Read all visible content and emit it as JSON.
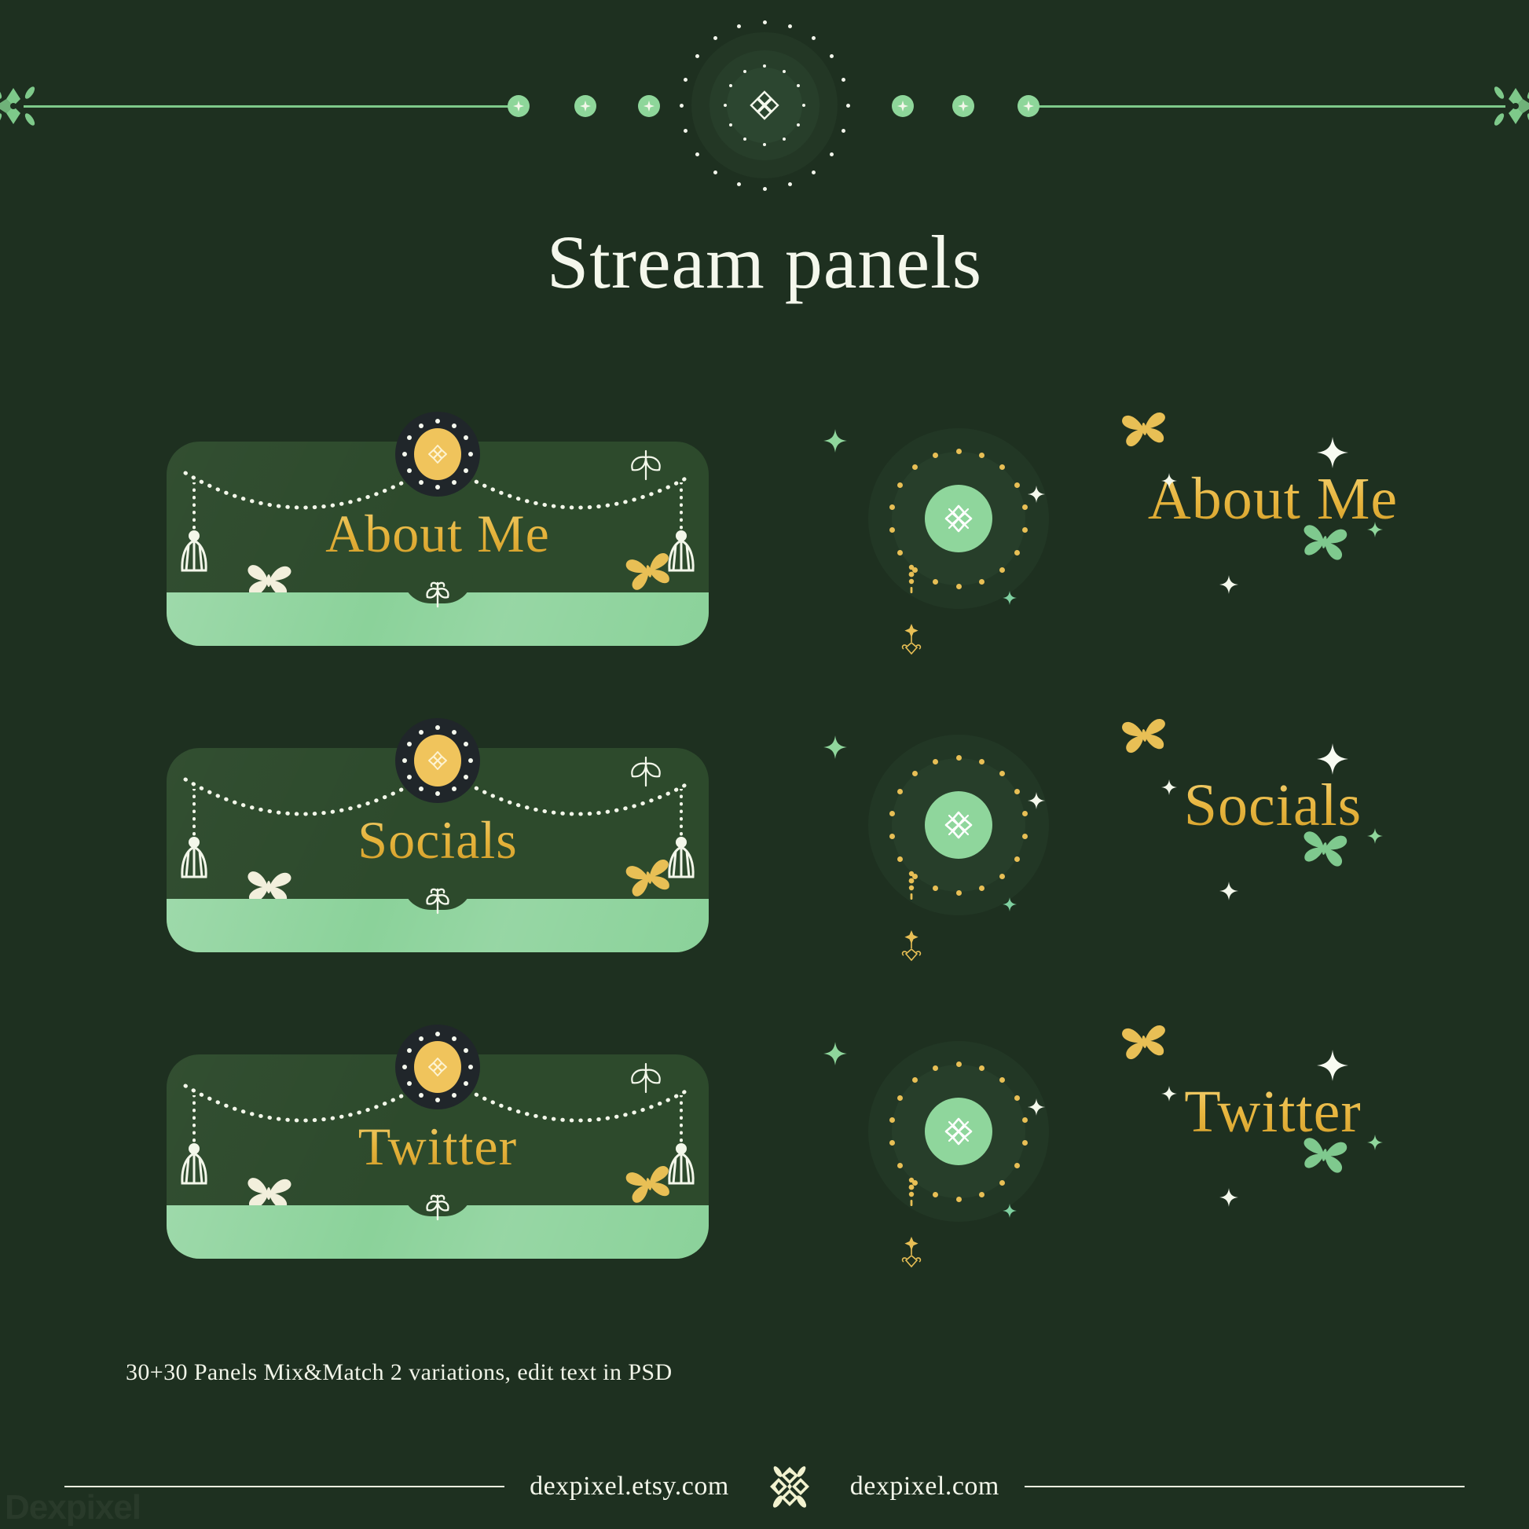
{
  "page": {
    "title": "Stream panels",
    "background_color": "#1e3020",
    "gold_color": "#e7b63f",
    "mint_color": "#8bd29a",
    "cream_color": "#f2f5e9"
  },
  "topbar": {
    "left_corner_icon": "floral-corner-ornament-icon",
    "right_corner_icon": "floral-corner-ornament-icon",
    "center_icon": "quatrefoil-medallion-icon",
    "bead_icon": "star-bead-icon",
    "bead_count": 6
  },
  "panels": [
    {
      "label": "About Me",
      "badge_icon": "sun-quatrefoil-icon",
      "left_tassel_icon": "tassel-icon",
      "right_tassel_icon": "tassel-icon",
      "left_butterfly_icon": "cream-butterfly-icon",
      "right_butterfly_icon": "gold-butterfly-icon",
      "top_sprig_icon": "sprig-icon",
      "footer_sprig_icon": "sprig-icon",
      "footer_color": "#8bd29a",
      "body_color": "#2d4a2c"
    },
    {
      "label": "Socials",
      "badge_icon": "sun-quatrefoil-icon",
      "left_tassel_icon": "tassel-icon",
      "right_tassel_icon": "tassel-icon",
      "left_butterfly_icon": "cream-butterfly-icon",
      "right_butterfly_icon": "gold-butterfly-icon",
      "top_sprig_icon": "sprig-icon",
      "footer_sprig_icon": "sprig-icon",
      "footer_color": "#8bd29a",
      "body_color": "#2d4a2c"
    },
    {
      "label": "Twitter",
      "badge_icon": "sun-quatrefoil-icon",
      "left_tassel_icon": "tassel-icon",
      "right_tassel_icon": "tassel-icon",
      "left_butterfly_icon": "cream-butterfly-icon",
      "right_butterfly_icon": "gold-butterfly-icon",
      "top_sprig_icon": "sprig-icon",
      "footer_sprig_icon": "sprig-icon",
      "footer_color": "#8bd29a",
      "body_color": "#2d4a2c"
    }
  ],
  "variants": [
    {
      "label": "About Me",
      "orb_icon": "quatrefoil-orb-icon",
      "pendant_icon": "crescent-moon-pendant-icon",
      "gold_butterfly_icon": "gold-butterfly-icon",
      "green_butterfly_icon": "green-butterfly-icon",
      "sparkle_icon": "four-point-sparkle-icon",
      "orb_color": "#8fd69c"
    },
    {
      "label": "Socials",
      "orb_icon": "quatrefoil-orb-icon",
      "pendant_icon": "crescent-moon-pendant-icon",
      "gold_butterfly_icon": "gold-butterfly-icon",
      "green_butterfly_icon": "green-butterfly-icon",
      "sparkle_icon": "four-point-sparkle-icon",
      "orb_color": "#8fd69c"
    },
    {
      "label": "Twitter",
      "orb_icon": "quatrefoil-orb-icon",
      "pendant_icon": "crescent-moon-pendant-icon",
      "gold_butterfly_icon": "gold-butterfly-icon",
      "green_butterfly_icon": "green-butterfly-icon",
      "sparkle_icon": "four-point-sparkle-icon",
      "orb_color": "#8fd69c"
    }
  ],
  "caption": "30+30 Panels Mix&Match 2 variations, edit text in PSD",
  "footer": {
    "etsy_link": "dexpixel.etsy.com",
    "site_link": "dexpixel.com",
    "mark_icon": "quatrefoil-logo-icon"
  },
  "watermark": "Dexpixel"
}
